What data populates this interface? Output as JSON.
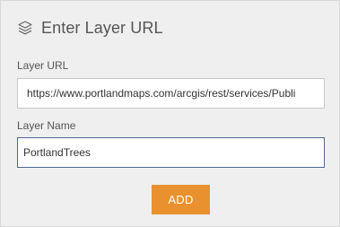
{
  "panel": {
    "title": "Enter Layer URL",
    "title_icon": "layers-icon"
  },
  "fields": {
    "url": {
      "label": "Layer URL",
      "value": "https://www.portlandmaps.com/arcgis/rest/services/Publi"
    },
    "name": {
      "label": "Layer Name",
      "value": "PortlandTrees"
    }
  },
  "actions": {
    "add_label": "ADD"
  },
  "colors": {
    "panel_background": "#efefef",
    "accent_button": "#e8912e",
    "focused_border": "#49698d",
    "text": "#555555"
  }
}
